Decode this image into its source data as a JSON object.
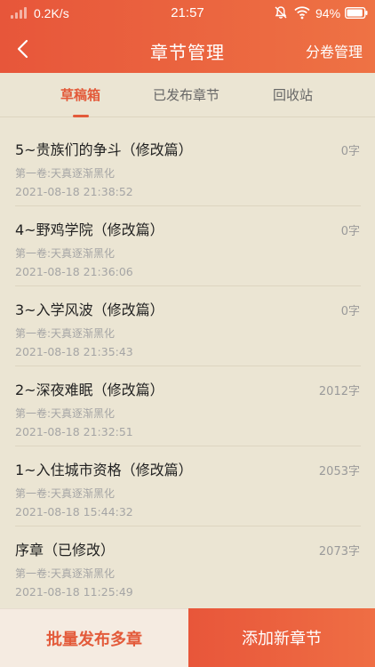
{
  "status_bar": {
    "net_speed": "0.2K/s",
    "time": "21:57",
    "battery": "94%"
  },
  "header": {
    "title": "章节管理",
    "volume_manage": "分卷管理"
  },
  "tabs": [
    {
      "label": "草稿箱",
      "active": true
    },
    {
      "label": "已发布章节",
      "active": false
    },
    {
      "label": "回收站",
      "active": false
    }
  ],
  "chapters": [
    {
      "title": "5~贵族们的争斗（修改篇）",
      "words": "0字",
      "volume": "第一卷:天真逐渐黑化",
      "time": "2021-08-18 21:38:52"
    },
    {
      "title": "4~野鸡学院（修改篇）",
      "words": "0字",
      "volume": "第一卷:天真逐渐黑化",
      "time": "2021-08-18 21:36:06"
    },
    {
      "title": "3~入学风波（修改篇）",
      "words": "0字",
      "volume": "第一卷:天真逐渐黑化",
      "time": "2021-08-18 21:35:43"
    },
    {
      "title": "2~深夜难眠（修改篇）",
      "words": "2012字",
      "volume": "第一卷:天真逐渐黑化",
      "time": "2021-08-18 21:32:51"
    },
    {
      "title": "1~入住城市资格（修改篇）",
      "words": "2053字",
      "volume": "第一卷:天真逐渐黑化",
      "time": "2021-08-18 15:44:32"
    },
    {
      "title": "序章（已修改）",
      "words": "2073字",
      "volume": "第一卷:天真逐渐黑化",
      "time": "2021-08-18 11:25:49"
    }
  ],
  "bottom": {
    "batch_publish": "批量发布多章",
    "add_chapter": "添加新章节"
  },
  "colors": {
    "accent": "#e35a3a",
    "background": "#ebe5d3"
  },
  "battery_level": 0.94
}
